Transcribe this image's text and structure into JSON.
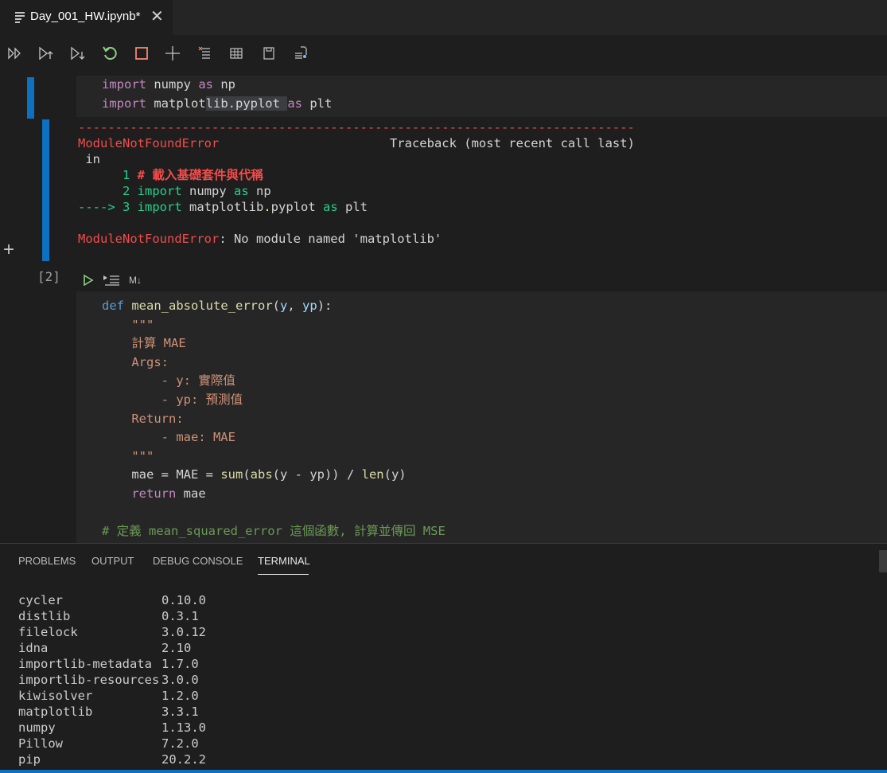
{
  "tab": {
    "title": "Day_001_HW.ipynb*",
    "close": "✕",
    "icon": "notebook-icon"
  },
  "toolbar": {
    "icons": [
      "run-all-icon",
      "run-above-icon",
      "run-below-icon",
      "restart-icon",
      "interrupt-icon",
      "add-cell-icon",
      "clear-outputs-icon",
      "variables-icon",
      "save-icon",
      "export-icon"
    ],
    "colors": {
      "restart": "#89d185",
      "interrupt": "#f48771"
    }
  },
  "cell1": {
    "lines": [
      {
        "kw": "import",
        "name": " numpy ",
        "as": "as",
        "alias": " np"
      },
      {
        "kw": "import",
        "name_a": " matplot",
        "name_b": "lib.pyplot ",
        "as": "as",
        "alias": " plt"
      }
    ]
  },
  "output": {
    "dashes": "---------------------------------------------------------------------------",
    "error_name": "ModuleNotFoundError",
    "traceback_pad": "                       ",
    "traceback": "Traceback (most recent call last)",
    "in_line": " in",
    "l1_num": "      1 ",
    "l1_comment": "# 載入基礎套件與代稱",
    "l2_num": "      2 ",
    "l2_kw": "import",
    "l2_rest": " numpy ",
    "l2_as": "as",
    "l2_alias": " np",
    "l3_arrow": "----> 3 ",
    "l3_kw": "import",
    "l3_a": " matplotlib",
    "l3_dot": ".",
    "l3_b": "pyplot ",
    "l3_as": "as",
    "l3_alias": " plt",
    "final_msg": ": No module named 'matplotlib'"
  },
  "cell2": {
    "execution_count": "[2]",
    "md_label": "M↓",
    "def_kw": "def",
    "fn_name": "mean_absolute_error",
    "paren_open": "(",
    "param_y": "y",
    "comma": ", ",
    "param_yp": "yp",
    "paren_close": "):",
    "doc_open": "\"\"\"",
    "doc_1": "計算 MAE",
    "doc_2": "Args:",
    "doc_3": "    - y: 實際值",
    "doc_4": "    - yp: 預測值",
    "doc_5": "Return:",
    "doc_6": "    - mae: MAE",
    "doc_close": "\"\"\"",
    "line_mae_a": "mae = MAE = ",
    "fn_sum": "sum",
    "p1": "(",
    "fn_abs": "abs",
    "line_mae_b": "(y - yp)) / ",
    "fn_len": "len",
    "line_mae_c": "(y)",
    "ret_kw": "return",
    "ret_val": " mae",
    "comment": "# 定義 mean_squared_error 這個函數, 計算並傳回 MSE"
  },
  "panel": {
    "tabs": [
      "PROBLEMS",
      "OUTPUT",
      "DEBUG CONSOLE",
      "TERMINAL"
    ],
    "active": "TERMINAL",
    "packages": [
      [
        "cycler",
        "0.10.0"
      ],
      [
        "distlib",
        "0.3.1"
      ],
      [
        "filelock",
        "3.0.12"
      ],
      [
        "idna",
        "2.10"
      ],
      [
        "importlib-metadata",
        "1.7.0"
      ],
      [
        "importlib-resources",
        "3.0.0"
      ],
      [
        "kiwisolver",
        "1.2.0"
      ],
      [
        "matplotlib",
        "3.3.1"
      ],
      [
        "numpy",
        "1.13.0"
      ],
      [
        "Pillow",
        "7.2.0"
      ],
      [
        "pip",
        "20.2.2"
      ]
    ]
  }
}
